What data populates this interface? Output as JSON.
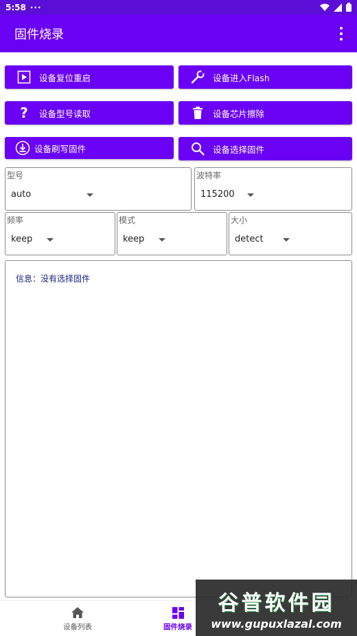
{
  "status_bar": {
    "time": "5:58",
    "dots": "···"
  },
  "app_bar": {
    "title": "固件烧录"
  },
  "buttons": {
    "reset": "设备复位重启",
    "flash_mode": "设备进入Flash",
    "read_model": "设备型号读取",
    "erase_chip": "设备芯片擦除",
    "write_firmware": "设备刷写固件",
    "select_firmware": "设备选择固件"
  },
  "fields": {
    "model": {
      "label": "型号",
      "value": "auto"
    },
    "baud": {
      "label": "波特率",
      "value": "115200"
    },
    "freq": {
      "label": "频率",
      "value": "keep"
    },
    "mode": {
      "label": "模式",
      "value": "keep"
    },
    "size": {
      "label": "大小",
      "value": "detect"
    }
  },
  "info": {
    "text": "信息：没有选择固件"
  },
  "bottom_nav": {
    "items": [
      {
        "label": "设备列表"
      },
      {
        "label": "固件烧录"
      }
    ]
  },
  "watermark": {
    "line1": "谷普软件园",
    "line2": "www.gupuxlazal.com"
  },
  "colors": {
    "primary": "#6a00f4",
    "status": "#5b0fd6",
    "info_text": "#1a237e"
  },
  "icons": [
    "play-box-icon",
    "wrench-icon",
    "question-icon",
    "trash-icon",
    "download-circle-icon",
    "magnifier-icon",
    "home-icon",
    "dashboard-icon"
  ]
}
